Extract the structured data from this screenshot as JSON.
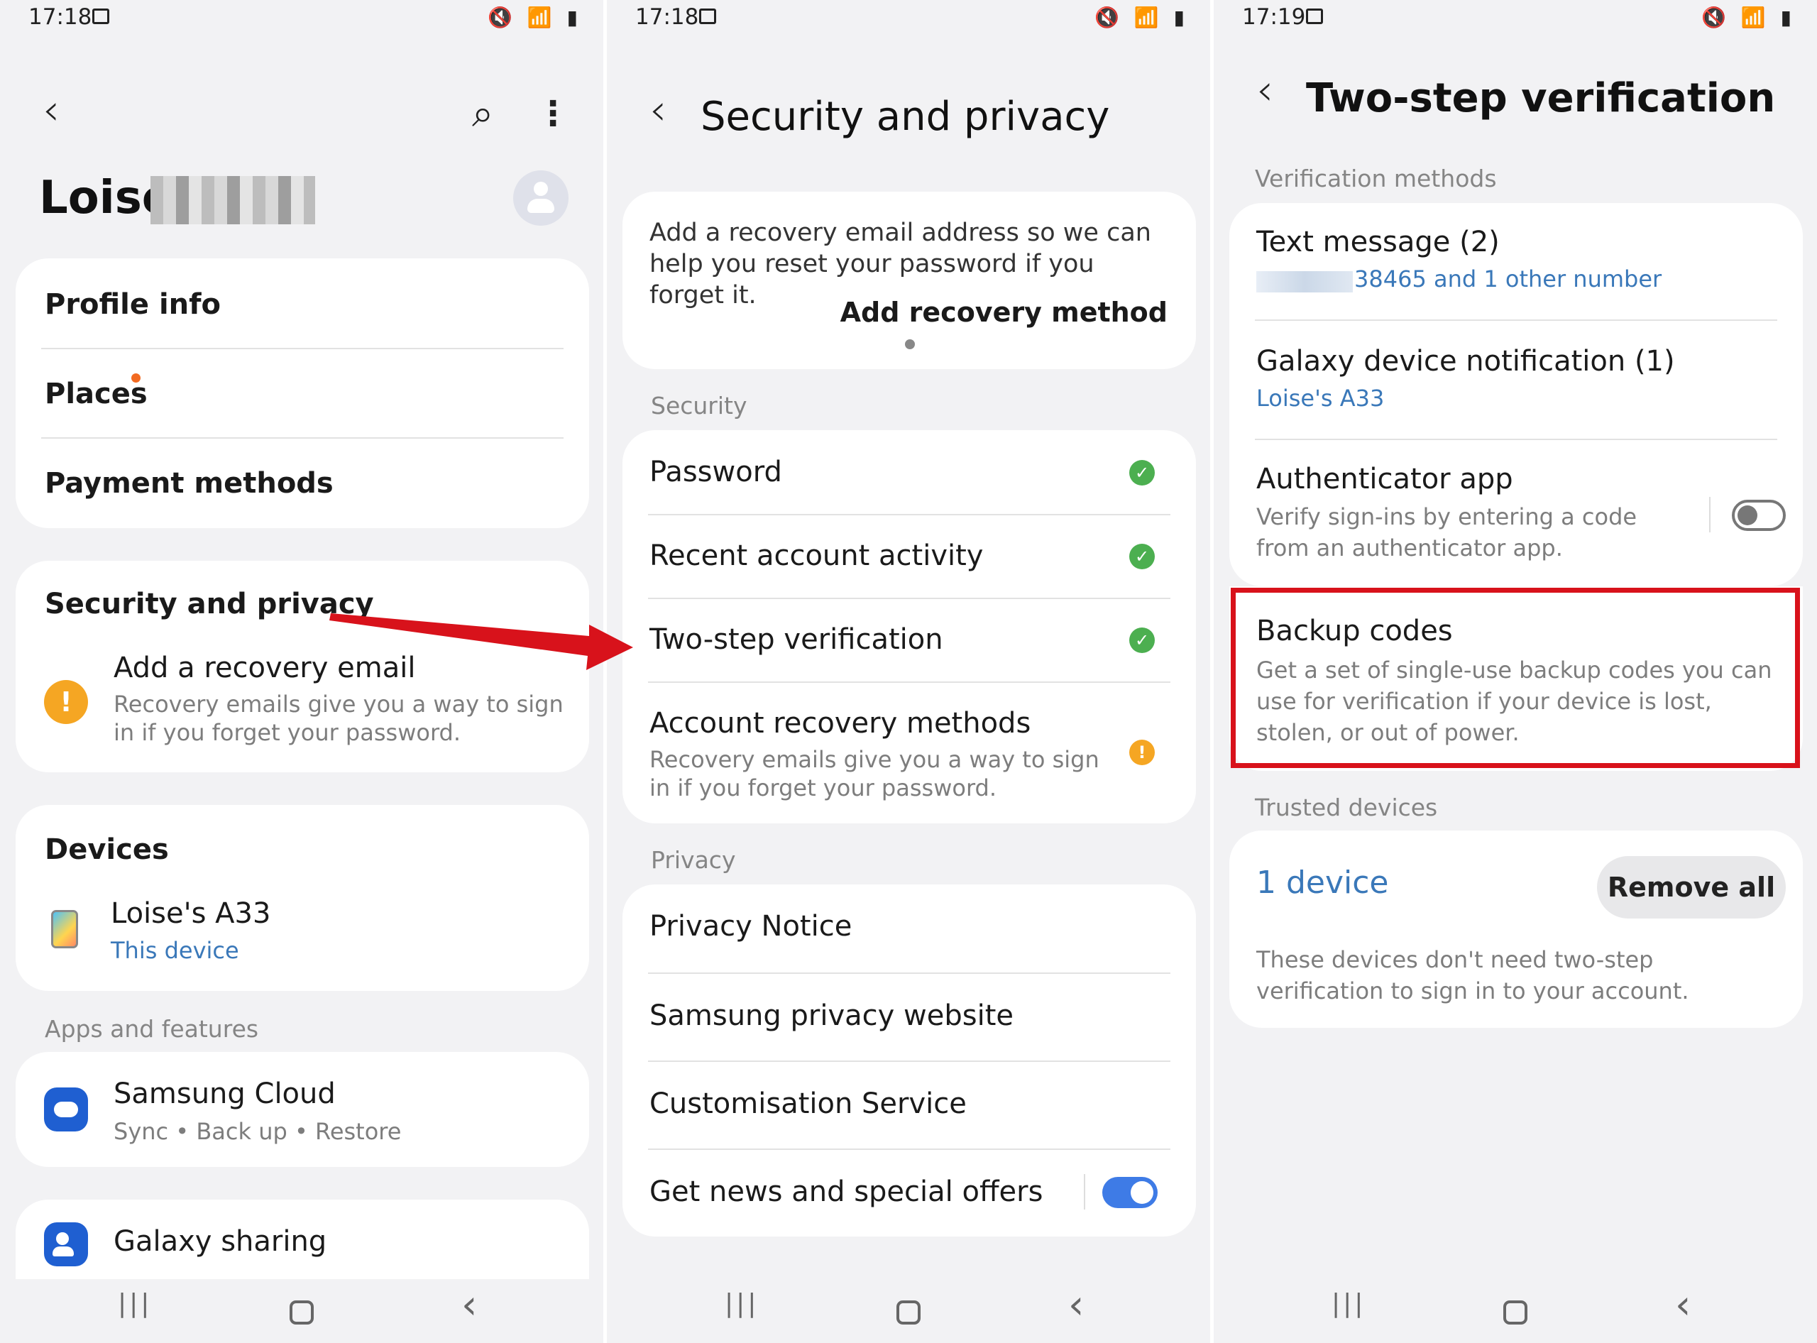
{
  "screen1": {
    "status": {
      "time": "17:18",
      "icons": "🔇 📶 ▮"
    },
    "back_glyph": "‹",
    "search_glyph": "⌕",
    "more_glyph": "⋮",
    "user_name": "Loise",
    "account_card": {
      "profile_info": "Profile info",
      "places": "Places",
      "payment_methods": "Payment methods"
    },
    "security_card": {
      "title": "Security and privacy",
      "item_title": "Add a recovery email",
      "item_desc": "Recovery emails give you a way to sign in if you forget your password.",
      "warn_glyph": "!"
    },
    "devices_card": {
      "title": "Devices",
      "device_name": "Loise's A33",
      "device_sub": "This device"
    },
    "apps_header": "Apps and features",
    "cloud_card": {
      "title": "Samsung Cloud",
      "sub": "Sync • Back up • Restore"
    },
    "sharing_card": {
      "title": "Galaxy sharing"
    }
  },
  "screen2": {
    "status": {
      "time": "17:18",
      "icons": "🔇 📶 ▮"
    },
    "back_glyph": "‹",
    "title": "Security and privacy",
    "recovery_card": {
      "text": "Add a recovery email address so we can help you reset your password if you forget it.",
      "action": "Add recovery method"
    },
    "security_header": "Security",
    "security_items": [
      {
        "label": "Password"
      },
      {
        "label": "Recent account activity"
      },
      {
        "label": "Two-step verification"
      },
      {
        "label": "Account recovery methods",
        "desc": "Recovery emails give you a way to sign in if you forget your password."
      }
    ],
    "check_glyph": "✓",
    "warn_glyph": "!",
    "privacy_header": "Privacy",
    "privacy_items": [
      {
        "label": "Privacy Notice"
      },
      {
        "label": "Samsung privacy website"
      },
      {
        "label": "Customisation Service"
      },
      {
        "label": "Get news and special offers",
        "toggle_on": true
      }
    ]
  },
  "screen3": {
    "status": {
      "time": "17:19",
      "icons": "🔇 📶 ▮"
    },
    "back_glyph": "‹",
    "title": "Two-step verification",
    "methods_header": "Verification methods",
    "methods": [
      {
        "title": "Text message (2)",
        "sub": "38465 and 1 other number"
      },
      {
        "title": "Galaxy device notification (1)",
        "sub": "Loise's A33"
      },
      {
        "title": "Authenticator app",
        "desc": "Verify sign-ins by entering a code from an authenticator app.",
        "toggle_on": false
      },
      {
        "title": "Backup codes",
        "desc": "Get a set of single-use backup codes you can use for verification if your device is lost, stolen, or out of power."
      }
    ],
    "trusted_header": "Trusted devices",
    "trusted_count": "1 device",
    "remove_all": "Remove all",
    "trusted_desc": "These devices don't need two-step verification to sign in to your account."
  },
  "navbar": {
    "recents": "|||",
    "back": "‹"
  },
  "colors": {
    "accent_blue": "#3a78b9",
    "toggle_on": "#3e7be6",
    "check_green": "#4caf50",
    "warn_orange": "#f5a623",
    "highlight_red": "#d8121b",
    "arrow_red": "#d8121b",
    "badge_orange": "#f26a21"
  }
}
